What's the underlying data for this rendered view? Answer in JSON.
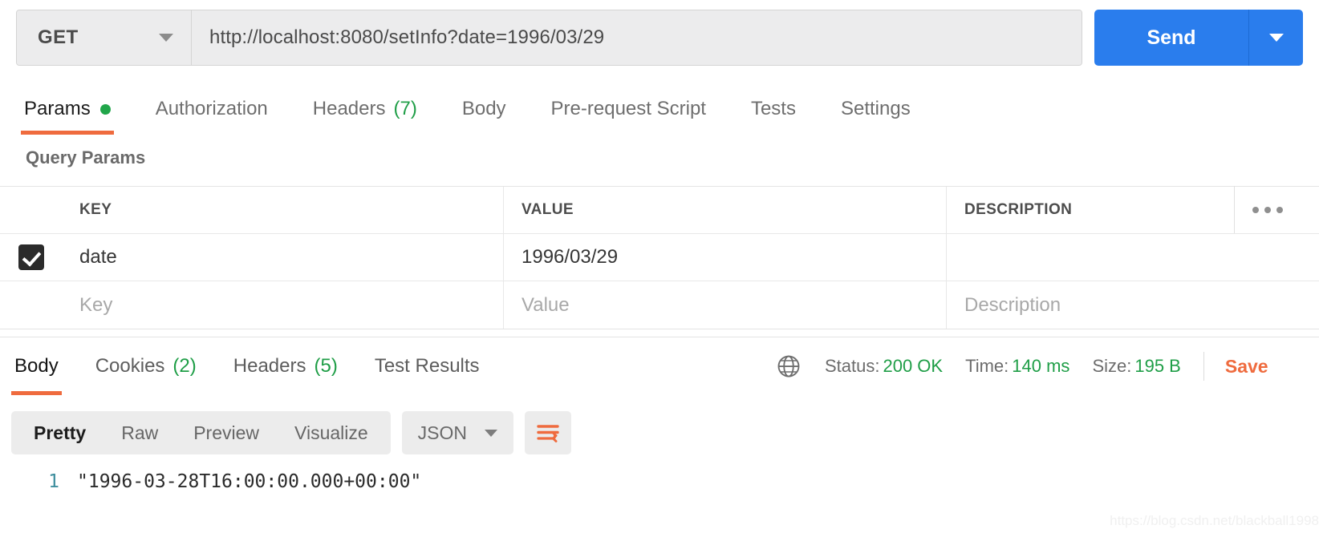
{
  "request": {
    "method": "GET",
    "method_caret_icon": "chevron-down-icon",
    "url": "http://localhost:8080/setInfo?date=1996/03/29",
    "send_label": "Send",
    "send_caret_icon": "chevron-down-icon"
  },
  "request_tabs": [
    {
      "label": "Params",
      "indicator": "dot",
      "active": true
    },
    {
      "label": "Authorization",
      "active": false
    },
    {
      "label": "Headers",
      "count": "(7)",
      "active": false
    },
    {
      "label": "Body",
      "active": false
    },
    {
      "label": "Pre-request Script",
      "active": false
    },
    {
      "label": "Tests",
      "active": false
    },
    {
      "label": "Settings",
      "active": false
    }
  ],
  "query_params": {
    "section_title": "Query Params",
    "columns": [
      "KEY",
      "VALUE",
      "DESCRIPTION"
    ],
    "more_icon": "ellipsis-icon",
    "rows": [
      {
        "checked": true,
        "key": "date",
        "value": "1996/03/29",
        "description": ""
      }
    ],
    "placeholder_row": {
      "key": "Key",
      "value": "Value",
      "description": "Description"
    }
  },
  "response_tabs": [
    {
      "label": "Body",
      "active": true
    },
    {
      "label": "Cookies",
      "count": "(2)",
      "active": false
    },
    {
      "label": "Headers",
      "count": "(5)",
      "active": false
    },
    {
      "label": "Test Results",
      "active": false
    }
  ],
  "response_meta": {
    "globe_icon": "globe-icon",
    "status_label": "Status:",
    "status_value": "200 OK",
    "time_label": "Time:",
    "time_value": "140 ms",
    "size_label": "Size:",
    "size_value": "195 B",
    "save_label": "Save"
  },
  "viewer": {
    "modes": [
      {
        "label": "Pretty",
        "active": true
      },
      {
        "label": "Raw",
        "active": false
      },
      {
        "label": "Preview",
        "active": false
      },
      {
        "label": "Visualize",
        "active": false
      }
    ],
    "language": "JSON",
    "language_caret_icon": "chevron-down-icon",
    "wrap_icon": "word-wrap-icon"
  },
  "body": {
    "lines": [
      {
        "num": "1",
        "code": "\"1996-03-28T16:00:00.000+00:00\""
      }
    ]
  },
  "watermark": "https://blog.csdn.net/blackball1998",
  "colors": {
    "accent_orange": "#ef6b3e",
    "send_blue": "#2a7ded",
    "success_green": "#1f9e47",
    "dot_green": "#21a64a"
  }
}
